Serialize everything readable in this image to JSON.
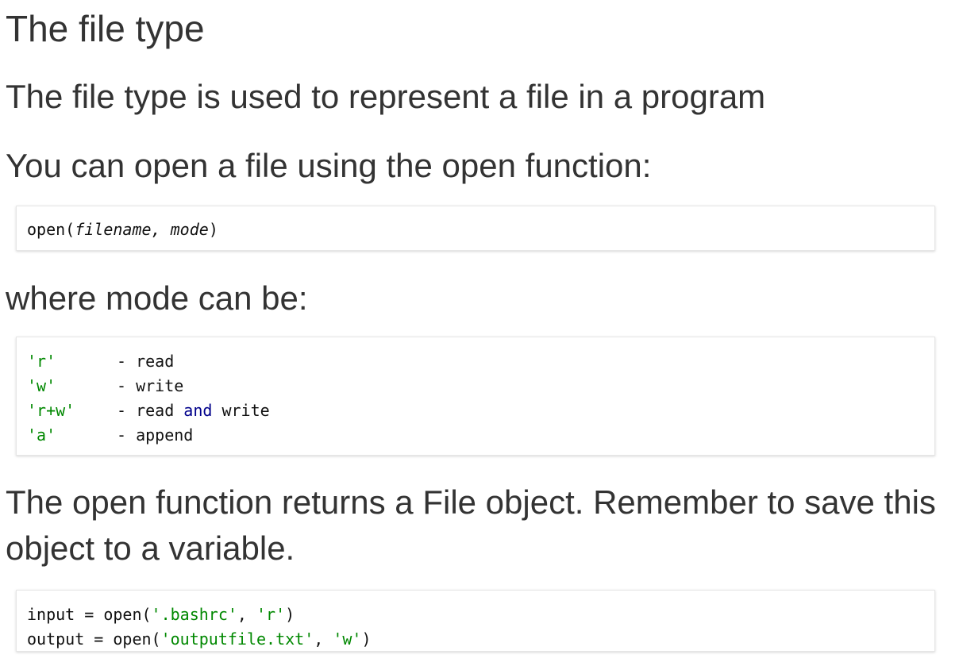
{
  "title": "The file type",
  "paragraphs": {
    "intro": "The file type is used to represent a file in a program",
    "open_hint": "You can open a file using the open function:",
    "mode_hint": "where mode can be:",
    "returns": "The open function returns a File object. Remember to save this object to a variable."
  },
  "signature": {
    "func": "open(",
    "param1": "filename",
    "sep": ", ",
    "param2": "mode",
    "close": ")"
  },
  "modes": [
    {
      "code": "'r'",
      "desc_pre": "- read",
      "desc_kw": "",
      "desc_post": ""
    },
    {
      "code": "'w'",
      "desc_pre": "- write",
      "desc_kw": "",
      "desc_post": ""
    },
    {
      "code": "'r+w'",
      "desc_pre": "- read ",
      "desc_kw": "and",
      "desc_post": " write"
    },
    {
      "code": "'a'",
      "desc_pre": "- append",
      "desc_kw": "",
      "desc_post": ""
    }
  ],
  "example": [
    {
      "pre": "input = open(",
      "arg1": "'.bashrc'",
      "mid": ", ",
      "arg2": "'r'",
      "post": ")"
    },
    {
      "pre": "output = open(",
      "arg1": "'outputfile.txt'",
      "mid": ", ",
      "arg2": "'w'",
      "post": ")"
    }
  ],
  "colors": {
    "text": "#333333",
    "string": "#008800",
    "keyword": "#00008b",
    "code_border": "#e6e6e6"
  }
}
